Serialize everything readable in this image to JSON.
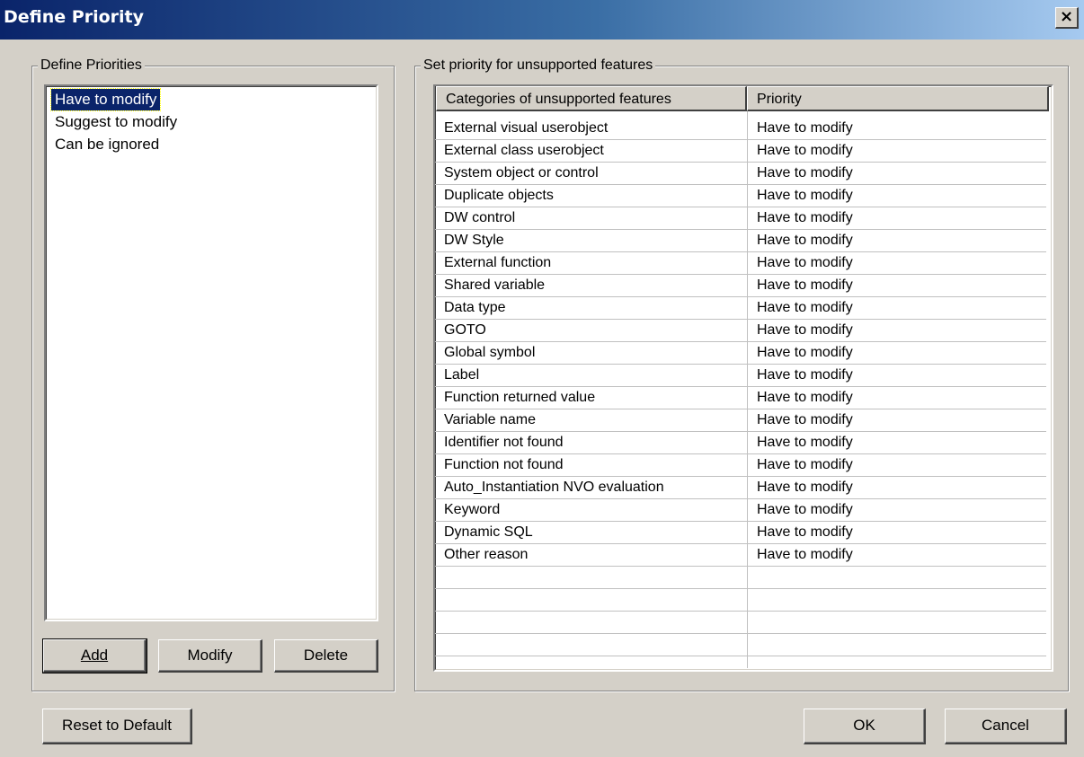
{
  "window": {
    "title": "Define Priority",
    "close_glyph": "×"
  },
  "left_group": {
    "legend": "Define Priorities",
    "priorities": [
      "Have to modify",
      "Suggest to modify",
      "Can be ignored"
    ],
    "selected_index": 0,
    "buttons": {
      "add": "Add",
      "modify": "Modify",
      "delete": "Delete"
    }
  },
  "right_group": {
    "legend": "Set priority for unsupported features",
    "columns": [
      "Categories of unsupported features",
      "Priority"
    ],
    "rows": [
      {
        "category": "External visual userobject",
        "priority": "Have to modify"
      },
      {
        "category": "External class userobject",
        "priority": "Have to modify"
      },
      {
        "category": "System object or control",
        "priority": "Have to modify"
      },
      {
        "category": "Duplicate objects",
        "priority": "Have to modify"
      },
      {
        "category": "DW control",
        "priority": "Have to modify"
      },
      {
        "category": "DW Style",
        "priority": "Have to modify"
      },
      {
        "category": "External function",
        "priority": "Have to modify"
      },
      {
        "category": "Shared variable",
        "priority": "Have to modify"
      },
      {
        "category": "Data type",
        "priority": "Have to modify"
      },
      {
        "category": "GOTO",
        "priority": "Have to modify"
      },
      {
        "category": "Global symbol",
        "priority": "Have to modify"
      },
      {
        "category": "Label",
        "priority": "Have to modify"
      },
      {
        "category": "Function returned value",
        "priority": "Have to modify"
      },
      {
        "category": "Variable name",
        "priority": "Have to modify"
      },
      {
        "category": "Identifier not found",
        "priority": "Have to modify"
      },
      {
        "category": "Function not found",
        "priority": "Have to modify"
      },
      {
        "category": "Auto_Instantiation NVO evaluation",
        "priority": "Have to modify"
      },
      {
        "category": "Keyword",
        "priority": "Have to modify"
      },
      {
        "category": "Dynamic SQL",
        "priority": "Have to modify"
      },
      {
        "category": "Other reason",
        "priority": "Have to modify"
      }
    ]
  },
  "footer": {
    "reset": "Reset to Default",
    "ok": "OK",
    "cancel": "Cancel"
  }
}
